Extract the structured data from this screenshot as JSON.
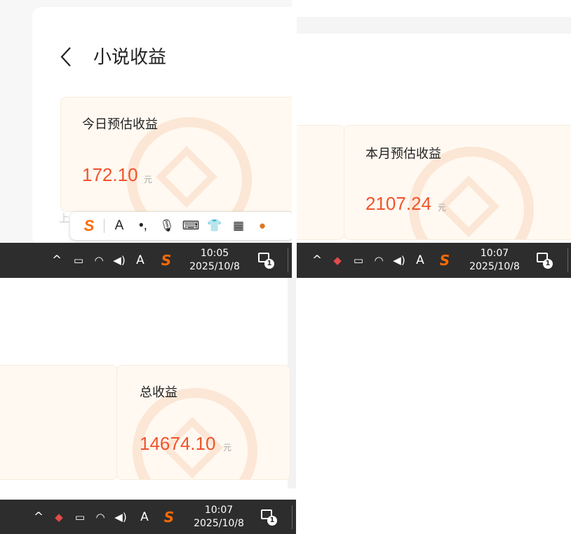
{
  "panel_top_left": {
    "title": "小说收益",
    "card": {
      "label": "今日预估收益",
      "amount": "172.10",
      "unit": "元"
    },
    "prev_label": "上",
    "ime_toolbar": {
      "items": [
        "S",
        "A",
        "•,",
        "mic-icon",
        "keyboard-icon",
        "skin-icon",
        "apps-icon",
        "mascot-icon"
      ]
    },
    "taskbar": {
      "input_indicator": "A",
      "time": "10:05",
      "date": "2025/10/8",
      "notification_count": "1"
    }
  },
  "panel_top_right": {
    "card": {
      "label": "本月预估收益",
      "amount": "2107.24",
      "unit": "元"
    },
    "taskbar": {
      "input_indicator": "A",
      "time": "10:07",
      "date": "2025/10/8",
      "notification_count": "1"
    }
  },
  "panel_bottom_left": {
    "card": {
      "label": "总收益",
      "amount": "14674.10",
      "unit": "元"
    },
    "taskbar": {
      "input_indicator": "A",
      "time": "10:07",
      "date": "2025/10/8",
      "notification_count": "1"
    }
  },
  "colors": {
    "accent": "#f1542c",
    "card_bg": "#fff9f1",
    "taskbar_bg": "#2d2d2d",
    "ime_logo": "#ff6a00"
  }
}
